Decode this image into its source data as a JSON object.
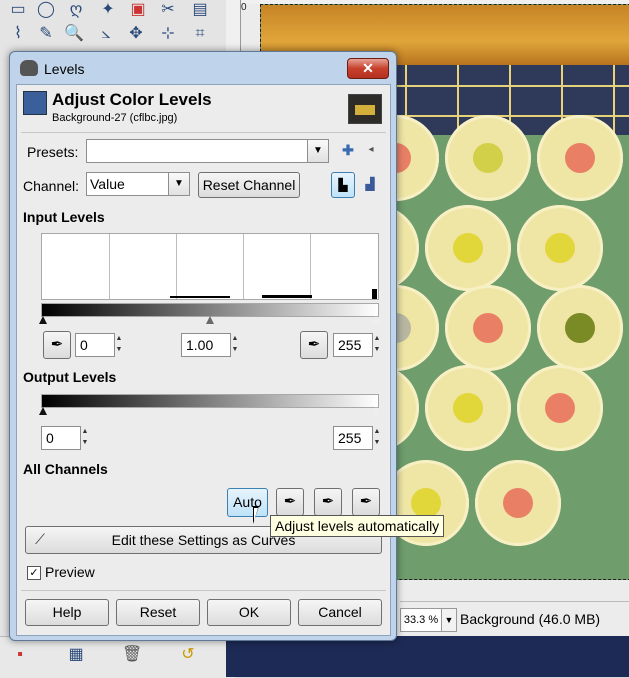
{
  "colors": {
    "dialog_frame": "#bfd4ea",
    "close_button": "#c7412c",
    "auto_button_hot": "#bfe2f8",
    "tooltip": "#ffffe1"
  },
  "dialog": {
    "window_title": "Levels",
    "close_glyph": "✕",
    "header": {
      "title": "Adjust Color Levels",
      "subtitle": "Background-27 (cflbc.jpg)"
    },
    "presets": {
      "label": "Presets:",
      "value": "",
      "add_icon": "plus-icon",
      "menu_icon": "menu-icon"
    },
    "channel": {
      "label": "Channel:",
      "value": "Value",
      "reset_label": "Reset Channel",
      "linear_icon": "linear-histogram-icon",
      "log_icon": "log-histogram-icon"
    },
    "input_levels": {
      "label": "Input Levels",
      "low": "0",
      "gamma": "1.00",
      "high": "255"
    },
    "output_levels": {
      "label": "Output Levels",
      "low": "0",
      "high": "255"
    },
    "all_channels": {
      "label": "All Channels",
      "auto_label": "Auto"
    },
    "edit_curves_label": "Edit these Settings as Curves",
    "preview": {
      "label": "Preview",
      "checked": true,
      "check_glyph": "✓"
    },
    "footer": {
      "help": "Help",
      "reset": "Reset",
      "ok": "OK",
      "cancel": "Cancel"
    }
  },
  "tooltip": "Adjust levels automatically",
  "image_window": {
    "ruler_zero": "0",
    "zoom": "33.3 %",
    "layer_info": "Background (46.0 MB)"
  }
}
